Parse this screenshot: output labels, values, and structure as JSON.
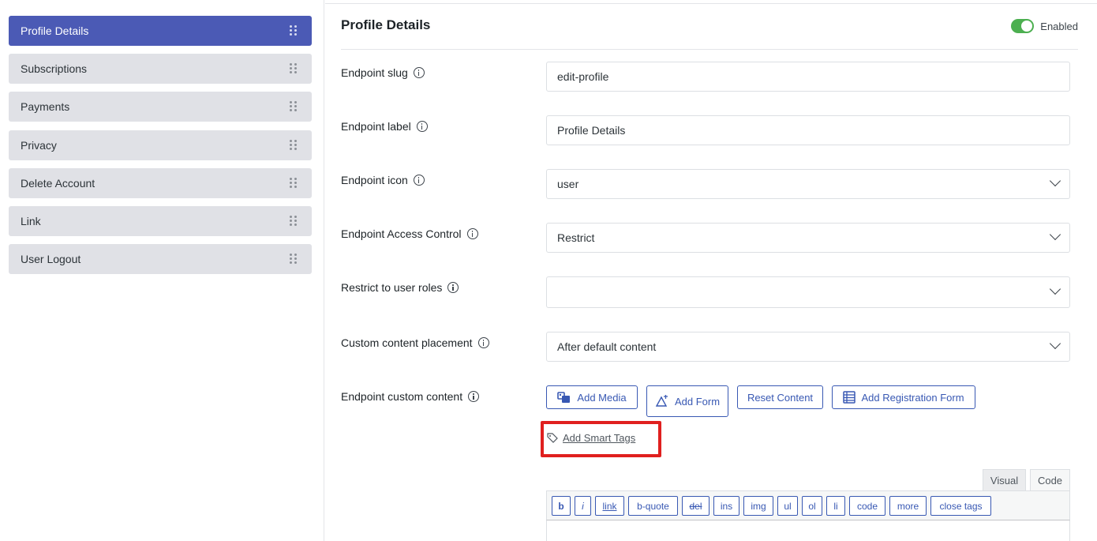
{
  "sidebar": {
    "items": [
      {
        "label": "Profile Details",
        "active": true
      },
      {
        "label": "Subscriptions",
        "active": false
      },
      {
        "label": "Payments",
        "active": false
      },
      {
        "label": "Privacy",
        "active": false
      },
      {
        "label": "Delete Account",
        "active": false
      },
      {
        "label": "Link",
        "active": false
      },
      {
        "label": "User Logout",
        "active": false
      }
    ]
  },
  "panel": {
    "title": "Profile Details",
    "toggle_label": "Enabled",
    "toggle_on": true
  },
  "fields": {
    "slug": {
      "label": "Endpoint slug",
      "value": "edit-profile"
    },
    "label": {
      "label": "Endpoint label",
      "value": "Profile Details"
    },
    "icon": {
      "label": "Endpoint icon",
      "value": "user"
    },
    "access": {
      "label": "Endpoint Access Control",
      "value": "Restrict"
    },
    "roles": {
      "label": "Restrict to user roles",
      "value": ""
    },
    "placement": {
      "label": "Custom content placement",
      "value": "After default content"
    },
    "content": {
      "label": "Endpoint custom content"
    }
  },
  "content_buttons": {
    "add_media": "Add Media",
    "add_form": "Add Form",
    "reset_content": "Reset Content",
    "add_registration_form": "Add Registration Form",
    "add_smart_tags": "Add Smart Tags"
  },
  "editor": {
    "tabs": {
      "visual": "Visual",
      "code": "Code"
    },
    "active_tab": "Code",
    "quicktags": [
      "b",
      "i",
      "link",
      "b-quote",
      "del",
      "ins",
      "img",
      "ul",
      "ol",
      "li",
      "code",
      "more",
      "close tags"
    ]
  },
  "colors": {
    "accent": "#4b5ab5",
    "button_blue": "#3858b3",
    "toggle_green": "#4caf50",
    "highlight_red": "#e0201f"
  }
}
